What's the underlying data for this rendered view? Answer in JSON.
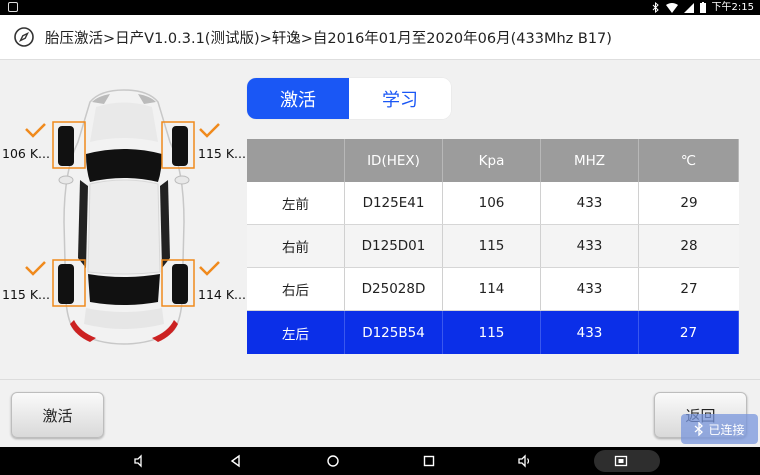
{
  "status_bar": {
    "time": "下午2:15",
    "icons": [
      "notification-icon",
      "bluetooth-icon",
      "wifi-icon",
      "signal-icon",
      "battery-icon"
    ]
  },
  "header": {
    "icon": "compass-icon",
    "title": "胎压激活>日产V1.0.3.1(测试版)>轩逸>自2016年01月至2020年06月(433Mhz B17)"
  },
  "wheels": {
    "front_left": {
      "label": "106 K...",
      "status": "checked"
    },
    "front_right": {
      "label": "115 K...",
      "status": "checked"
    },
    "rear_left": {
      "label": "115 K...",
      "status": "checked"
    },
    "rear_right": {
      "label": "114 K...",
      "status": "checked"
    }
  },
  "tabs": [
    {
      "label": "激活",
      "active": true
    },
    {
      "label": "学习",
      "active": false
    }
  ],
  "table": {
    "columns": [
      "",
      "ID(HEX)",
      "Kpa",
      "MHZ",
      "℃"
    ],
    "rows": [
      [
        "左前",
        "D125E41",
        "106",
        "433",
        "29"
      ],
      [
        "右前",
        "D125D01",
        "115",
        "433",
        "28"
      ],
      [
        "右后",
        "D25028D",
        "114",
        "433",
        "27"
      ],
      [
        "左后",
        "D125B54",
        "115",
        "433",
        "27"
      ]
    ],
    "selected_row": 3
  },
  "buttons": {
    "activate": "激活",
    "back": "返回"
  },
  "bluetooth_badge": {
    "label": "已连接",
    "icon": "bluetooth-icon"
  },
  "colors": {
    "accent": "#1a57f5",
    "selected_row": "#0b2fe8",
    "header_row": "#9c9c9c",
    "check": "#f08a1c"
  }
}
